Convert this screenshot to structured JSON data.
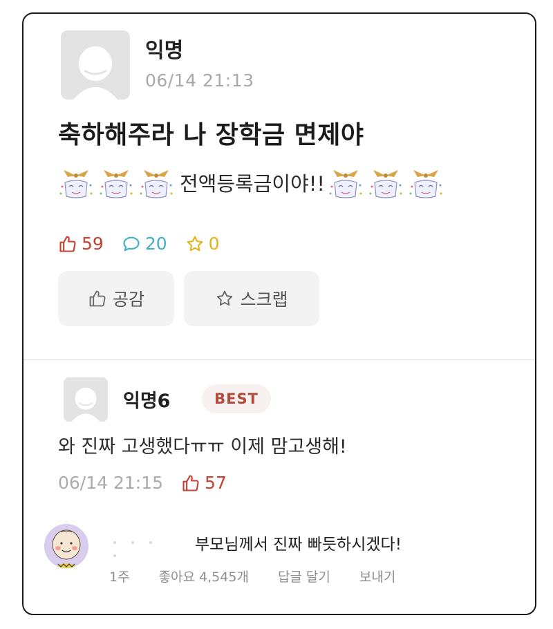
{
  "post": {
    "author": "익명",
    "timestamp": "06/14 21:13",
    "title": "축하해주라 나 장학금 면제야",
    "body": "전액등록금이야!!",
    "stats": {
      "likes": "59",
      "comments": "20",
      "scraps": "0"
    },
    "buttons": {
      "like": "공감",
      "scrap": "스크랩"
    },
    "icons": [
      "user-avatar-icon",
      "celebration-emoji-icon",
      "thumbs-up-icon",
      "comment-bubble-icon",
      "star-icon"
    ]
  },
  "best_comment": {
    "author": "익명6",
    "badge": "BEST",
    "text": "와 진짜 고생했다ㅠㅠ 이제 맘고생해!",
    "timestamp": "06/14 21:15",
    "likes": "57"
  },
  "reply": {
    "text": "부모님께서 진짜 빠듯하시겠다!",
    "actions": {
      "age": "1주",
      "likes": "좋아요 4,545개",
      "reply": "답글 달기",
      "send": "보내기"
    }
  },
  "colors": {
    "like": "#c8402e",
    "comment": "#3fb0c2",
    "scrap": "#e2b31a",
    "badge_text": "#b04a3c",
    "muted": "#a9a9a9"
  }
}
